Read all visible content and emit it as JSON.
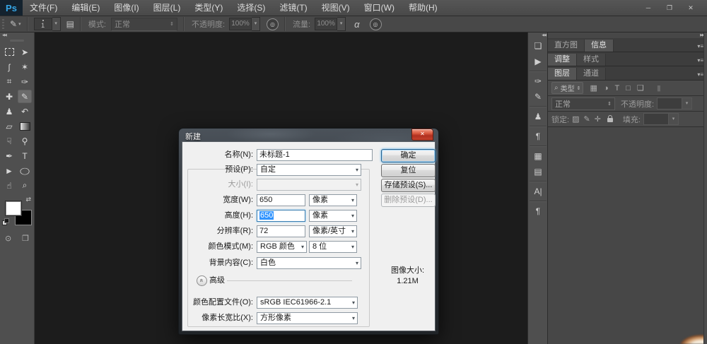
{
  "app": {
    "logo": "Ps",
    "menu": [
      "文件(F)",
      "编辑(E)",
      "图像(I)",
      "图层(L)",
      "类型(Y)",
      "选择(S)",
      "滤镜(T)",
      "视图(V)",
      "窗口(W)",
      "帮助(H)"
    ]
  },
  "options_bar": {
    "brush_size": "1",
    "mode_label": "模式:",
    "mode_value": "正常",
    "opacity_label": "不透明度:",
    "opacity_value": "100%",
    "flow_label": "流量:",
    "flow_value": "100%"
  },
  "panels": {
    "tabs": {
      "histogram": "直方图",
      "info": "信息",
      "adjustments": "调整",
      "styles": "样式",
      "layers": "图层",
      "channels": "通道"
    },
    "layers": {
      "filter_label": "类型",
      "blend_value": "正常",
      "opacity_label": "不透明度:",
      "lock_label": "锁定:",
      "fill_label": "填充:"
    }
  },
  "dialog": {
    "title": "新建",
    "fields": {
      "name_label": "名称(N):",
      "name_value": "未标题-1",
      "preset_label": "预设(P):",
      "preset_value": "自定",
      "size_label": "大小(I):",
      "size_value": "",
      "width_label": "宽度(W):",
      "width_value": "650",
      "width_unit": "像素",
      "height_label": "高度(H):",
      "height_value": "650",
      "height_unit": "像素",
      "resolution_label": "分辨率(R):",
      "resolution_value": "72",
      "resolution_unit": "像素/英寸",
      "colormode_label": "颜色模式(M):",
      "colormode_value": "RGB 颜色",
      "depth_value": "8 位",
      "background_label": "背景内容(C):",
      "background_value": "白色",
      "advanced_label": "高级",
      "profile_label": "颜色配置文件(O):",
      "profile_value": "sRGB IEC61966-2.1",
      "aspect_label": "像素长宽比(X):",
      "aspect_value": "方形像素"
    },
    "buttons": {
      "ok": "确定",
      "reset": "复位",
      "save_preset": "存储预设(S)...",
      "delete_preset": "删除预设(D)..."
    },
    "image_size_label": "图像大小:",
    "image_size_value": "1.21M"
  },
  "colors": {
    "ps_blue": "#36a7e8",
    "selection_blue": "#3194ff",
    "close_red": "#c4422c",
    "canvas": "#1c1c1c",
    "panel_gray": "#474747"
  },
  "icons": {
    "minimize": "─",
    "restore": "❐",
    "close": "✕",
    "dropdown": "▾",
    "stepper": "⇕",
    "menu": "▾≡",
    "collapse_left": "◀◀",
    "collapse_right": "▶▶",
    "tool_preset_brush": "✎",
    "brush_panel": "▤",
    "pen_pressure": "◎",
    "airbrush": "α",
    "move": "➤",
    "lasso": "ʃ",
    "magic_wand": "✶",
    "crop": "⌗",
    "eyedropper": "✑",
    "healing": "✚",
    "brush": "✎",
    "clone_stamp": "♟",
    "history_brush": "↶",
    "eraser": "▱",
    "smudge": "☟",
    "dodge": "⚲",
    "pen": "✒",
    "type": "T",
    "path_select": "►",
    "ellipse": "◯",
    "hand": "☝",
    "zoom": "⌕",
    "swap": "⇄",
    "quick_mask": "⊙",
    "screen_mode": "❐",
    "strip0": "❏",
    "strip1": "▶",
    "strip2": "✑",
    "strip3": "✎",
    "strip4": "♟",
    "strip5": "¶",
    "strip6": "▦",
    "strip7": "▤",
    "strip8": "A|",
    "strip9": "¶",
    "search": "⌕",
    "filter_pixel": "▦",
    "filter_adjust": "◑",
    "filter_type": "T",
    "filter_shape": "□",
    "filter_smart": "❏",
    "filter_toggle": "▮",
    "lock_transparent": "▨",
    "lock_brush": "✎",
    "lock_move": "✛",
    "advanced_chevron": "«"
  }
}
